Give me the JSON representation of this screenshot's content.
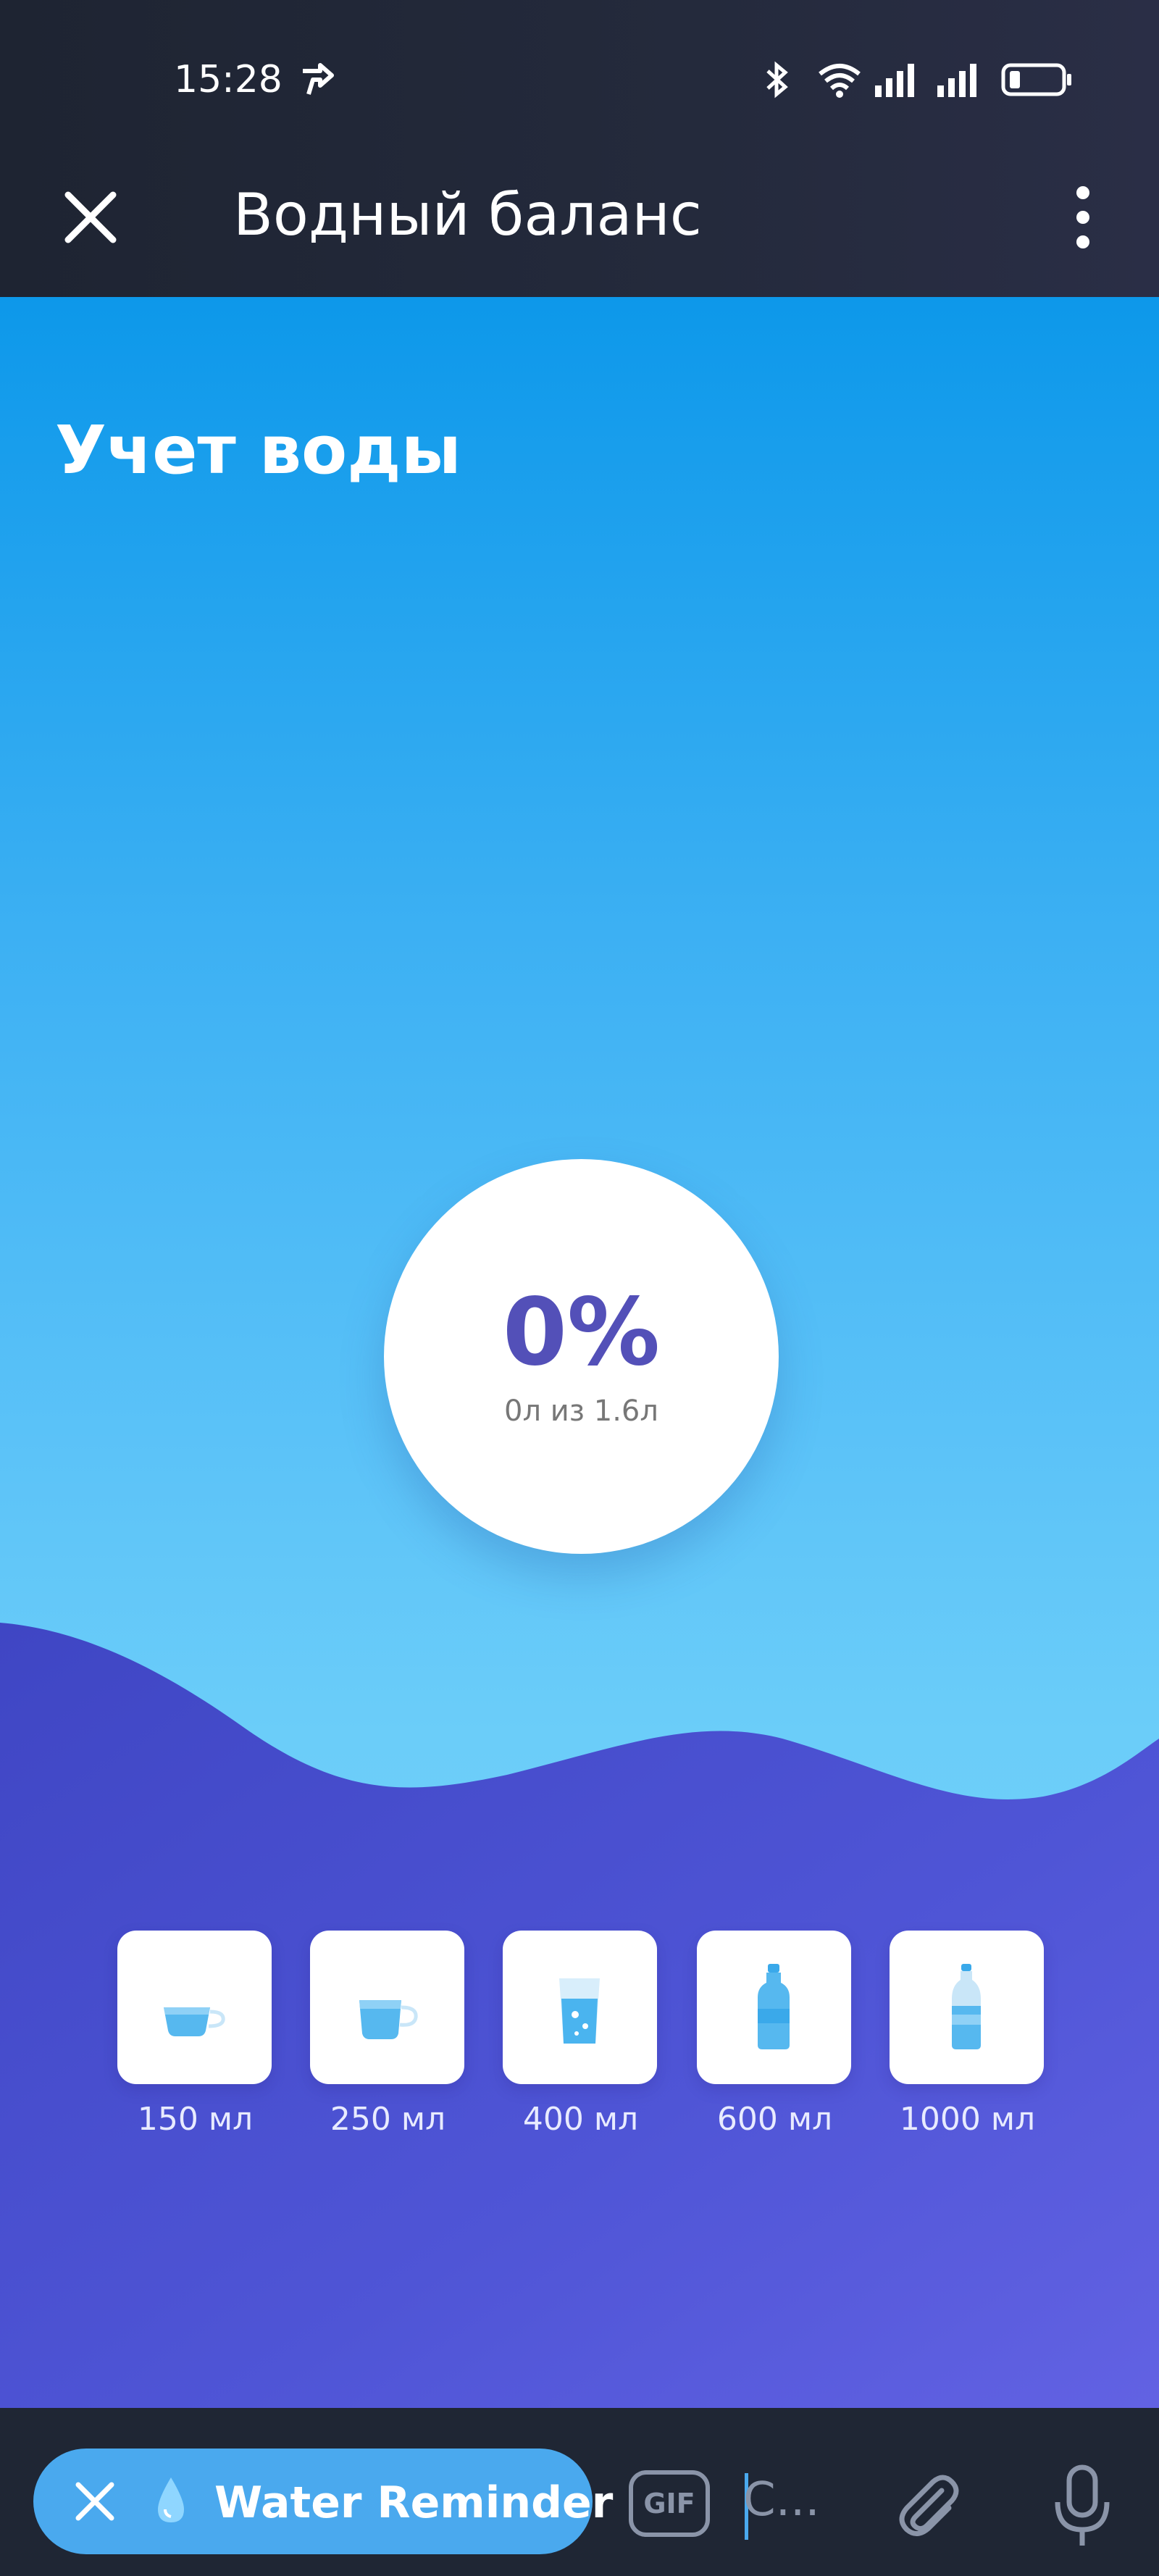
{
  "status_bar": {
    "time": "15:28",
    "icons": [
      "call-forward-icon",
      "bluetooth-icon",
      "wifi-icon",
      "signal-icon",
      "signal-icon",
      "battery-icon"
    ]
  },
  "app_bar": {
    "title": "Водный баланс",
    "close_icon": "close-icon",
    "menu_icon": "more-vertical-icon"
  },
  "main": {
    "section_title": "Учет воды",
    "progress": {
      "percent_text": "0%",
      "percent_value": 0,
      "subtitle": "0л из 1.6л"
    },
    "presets": [
      {
        "label": "150 мл",
        "icon": "cup-icon"
      },
      {
        "label": "250 мл",
        "icon": "mug-icon"
      },
      {
        "label": "400 мл",
        "icon": "glass-icon"
      },
      {
        "label": "600 мл",
        "icon": "bottle-icon"
      },
      {
        "label": "1000 мл",
        "icon": "large-bottle-icon"
      }
    ]
  },
  "bottom_bar": {
    "chip_label": "Water Reminder",
    "gif_label": "GIF",
    "input_text": "С..."
  },
  "colors": {
    "sky_top": "#0d98ea",
    "sky_bottom": "#74d2fa",
    "wave_purple": "#4b4fcf",
    "accent_text": "#5350b8",
    "chip_bg": "#4aa9ee"
  }
}
